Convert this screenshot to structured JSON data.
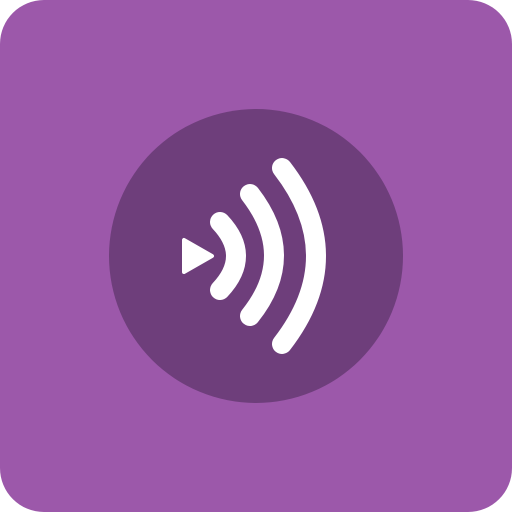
{
  "icon": {
    "semantic": "play-broadcast-icon",
    "colors": {
      "tile": "#9c58aa",
      "circle": "#6e3e7b",
      "glyph": "#ffffff"
    }
  }
}
